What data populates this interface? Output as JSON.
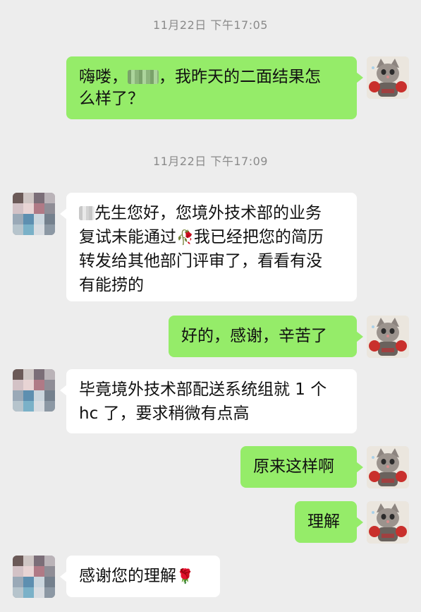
{
  "timestamps": [
    "11月22日 下午17:05",
    "11月22日 下午17:09"
  ],
  "messages": [
    {
      "from": "me",
      "lines": [
        "嗨喽，",
        "，我昨天的二面结果怎",
        "么样了？"
      ]
    },
    {
      "from": "them",
      "lines": [
        "先生您好，您境外技术部的业务",
        "复试未能通过",
        "我已经把您的简历",
        "转发给其他部门评审了，看看有没",
        "有能捞的"
      ]
    },
    {
      "from": "me",
      "text": "好的，感谢，辛苦了"
    },
    {
      "from": "them",
      "lines": [
        "毕竟境外技术部配送系统组就 1 个",
        "hc 了，要求稍微有点高"
      ]
    },
    {
      "from": "me",
      "text": "原来这样啊"
    },
    {
      "from": "me",
      "text": "理解"
    },
    {
      "from": "them",
      "text": "感谢您的理解"
    }
  ],
  "emojis": {
    "wilted_rose": "🥀",
    "rose": "🌹"
  },
  "avatars": {
    "me": "cat-boxing-avatar",
    "them": "blurred-contact-avatar"
  }
}
